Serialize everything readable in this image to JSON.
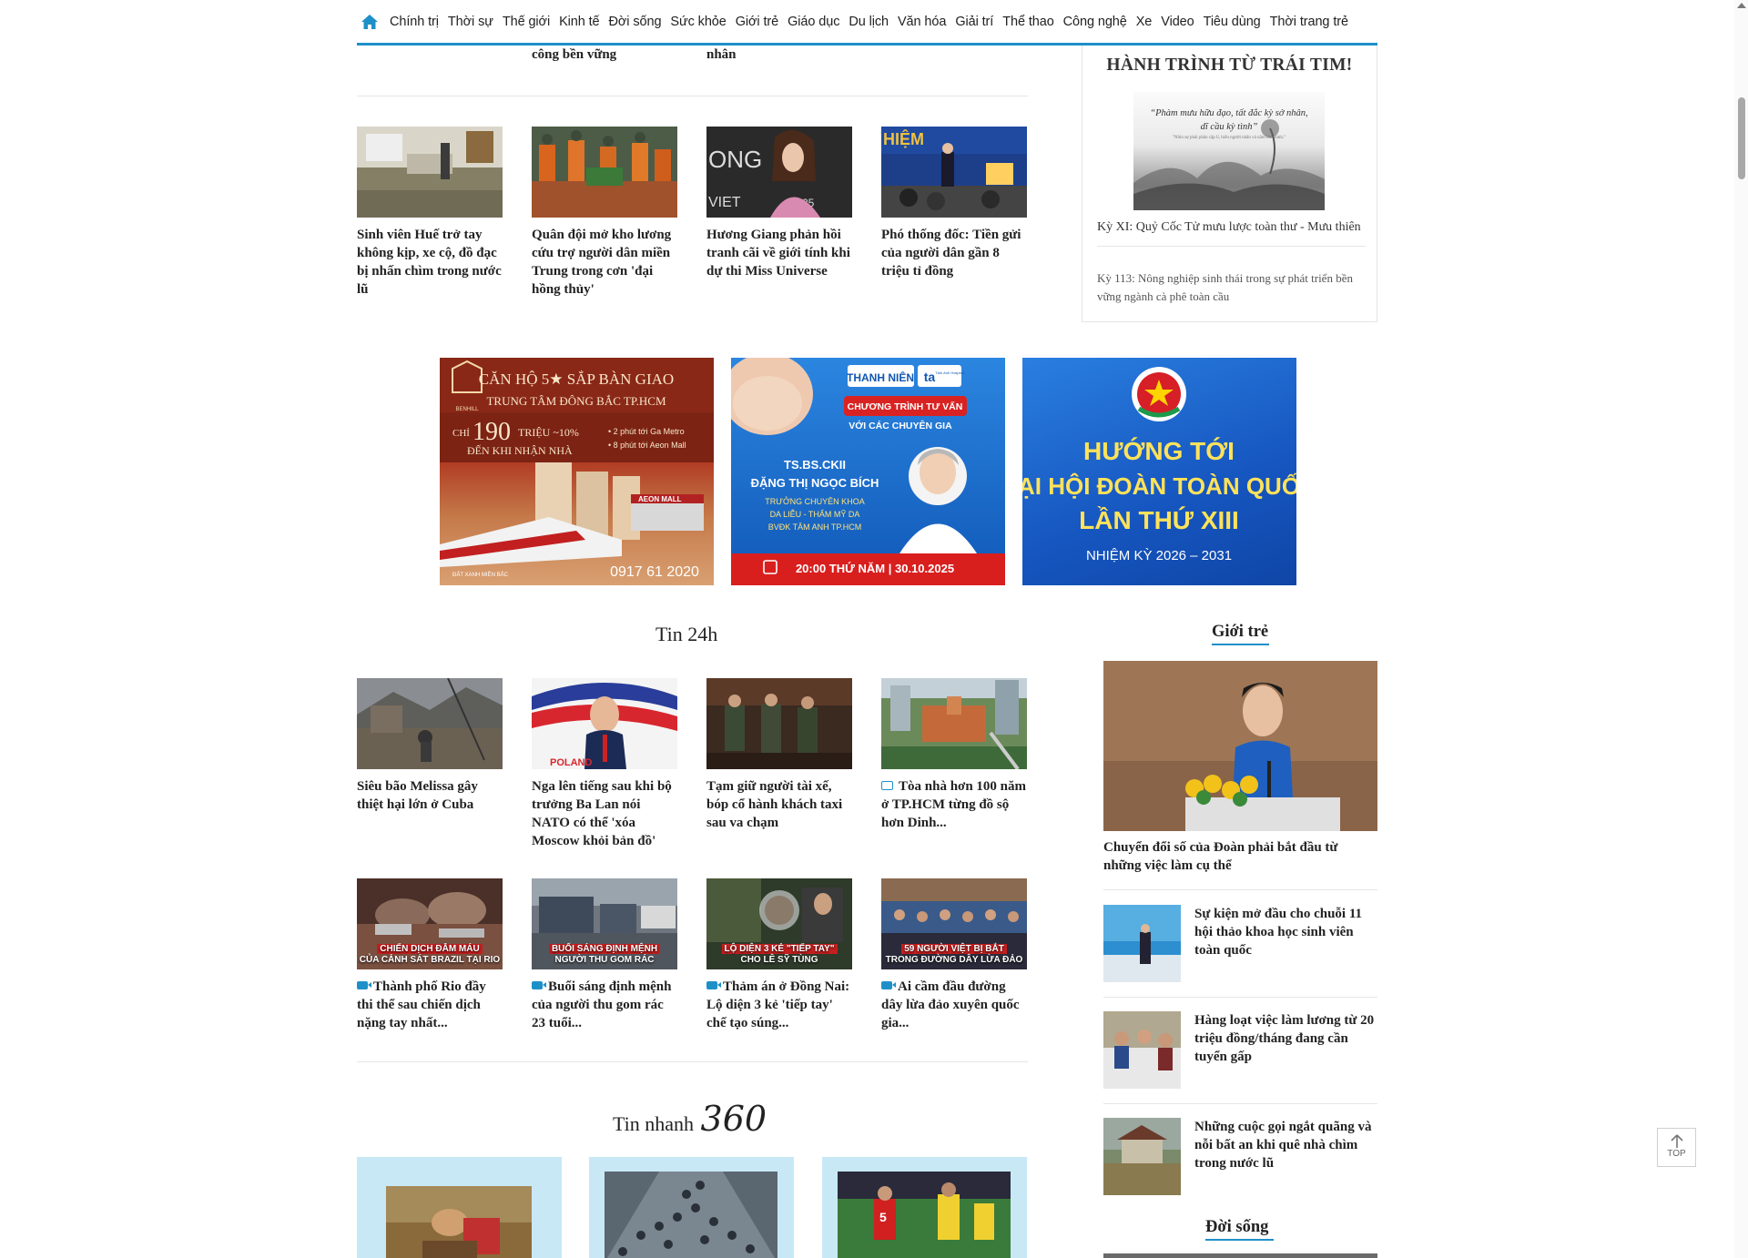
{
  "nav": {
    "items": [
      "Chính trị",
      "Thời sự",
      "Thế giới",
      "Kinh tế",
      "Đời sống",
      "Sức khỏe",
      "Giới trẻ",
      "Giáo dục",
      "Du lịch",
      "Văn hóa",
      "Giải trí",
      "Thể thao",
      "Công nghệ",
      "Xe",
      "Video",
      "Tiêu dùng",
      "Thời trang trẻ"
    ]
  },
  "cut_row": {
    "title_1": "công bền vững",
    "title_2": "nhân"
  },
  "row1": [
    {
      "title": "Sinh viên Huế trở tay không kịp, xe cộ, đồ đạc bị nhấn chìm trong nước lũ"
    },
    {
      "title": "Quân đội mở kho lương cứu trợ người dân miền Trung trong cơn 'đại hồng thủy'"
    },
    {
      "title": "Hương Giang phản hồi tranh cãi về giới tính khi dự thi Miss Universe"
    },
    {
      "title": "Phó thống đốc: Tiền gửi của người dân gần 8 triệu tỉ đồng"
    }
  ],
  "hanh_trinh": {
    "title": "HÀNH TRÌNH TỪ TRÁI TIM!",
    "quote": "“Phàm mưu hữu đạo, tất đắc kỳ sở nhân, dĩ cầu kỳ tình”",
    "quote_small": "\"Nhìn sự phải phân cặp lí, hiểu người nhân và nắm tình hình.\"",
    "link_1": "Kỳ XI: Quỷ Cốc Tử mưu lược toàn thư - Mưu thiên",
    "link_2": "Kỳ 113: Nông nghiệp sinh thái trong sự phát triển bền vững ngành cà phê toàn cầu"
  },
  "ads": {
    "ad1": {
      "brand": "BENHILL",
      "headline": "CĂN HỘ 5★ SẮP BÀN GIAO",
      "sub": "TRUNG TÂM ĐÔNG BẮC TP.HCM",
      "price_prefix": "CHỈ",
      "price": "190",
      "price_suffix": "TRIỆU ~10%",
      "price_line2": "ĐẾN KHI NHẬN NHÀ",
      "bullet_1": "• 2 phút tới Ga Metro",
      "bullet_2": "• 8 phút tới Aeon Mall",
      "mall": "AEON MALL",
      "footer_brand": "ĐẤT XANH MIỀN BẮC",
      "phone": "0917 61 2020"
    },
    "ad2": {
      "logo_1": "THANH NIÊN",
      "logo_2": "ta",
      "logo_2_sub": "Tâm Anh Hospital",
      "program": "CHƯƠNG TRÌNH TƯ VẤN",
      "with": "VỚI CÁC CHUYÊN GIA",
      "degree": "TS.BS.CKII",
      "name": "ĐẶNG THỊ NGỌC BÍCH",
      "role_1": "TRƯỞNG CHUYÊN KHOA",
      "role_2": "DA LIỄU - THẨM MỸ DA",
      "role_3": "BVĐK TÂM ANH TP.HCM",
      "time": "20:00 THỨ NĂM | 30.10.2025"
    },
    "ad3": {
      "line_1": "HƯỚNG TỚI",
      "line_2": "ĐẠI HỘI ĐOÀN TOÀN QUỐC",
      "line_3": "LẦN THỨ XIII",
      "term": "NHIỆM KỲ 2026 – 2031"
    }
  },
  "tin24h": {
    "title": "Tin 24h",
    "row_a": [
      {
        "title": "Siêu bão Melissa gây thiệt hại lớn ở Cuba"
      },
      {
        "title": "Nga lên tiếng sau khi bộ trưởng Ba Lan nói NATO có thể 'xóa Moscow khỏi bản đồ'",
        "thumb_text": "POLAND"
      },
      {
        "title": "Tạm giữ người tài xế, bóp cổ hành khách taxi sau va chạm"
      },
      {
        "title": "Tòa nhà hơn 100 năm ở TP.HCM từng đồ sộ hơn Dinh..."
      }
    ],
    "row_b": [
      {
        "title": "Thành phố Rio đầy thi thể sau chiến dịch nặng tay nhất...",
        "label_1": "CHIẾN DỊCH ĐẪM MÁU",
        "label_2": "CỦA CẢNH SÁT BRAZIL TẠI RIO"
      },
      {
        "title": "Buổi sáng định mệnh của người thu gom rác 23 tuổi...",
        "label_1": "BUỔI SÁNG ĐỊNH MỆNH",
        "label_2": "NGƯỜI THU GOM RÁC"
      },
      {
        "title": "Thảm án ở Đồng Nai: Lộ diện 3 kẻ 'tiếp tay' chế tạo súng...",
        "label_1": "LỘ DIỆN 3 KẺ \"TIẾP TAY\"",
        "label_2": "CHO LÊ SỸ TÙNG"
      },
      {
        "title": "Ai cầm đầu đường dây lừa đảo xuyên quốc gia...",
        "label_1": "59 NGƯỜI VIỆT BỊ BẮT",
        "label_2": "TRONG ĐƯỜNG DÂY LỪA ĐẢO"
      }
    ]
  },
  "gioi_tre": {
    "title": "Giới trẻ",
    "lead_title": "Chuyển đổi số của Đoàn phải bắt đầu từ những việc làm cụ thể",
    "items": [
      {
        "title": "Sự kiện mở đầu cho chuỗi 11 hội thảo khoa học sinh viên toàn quốc"
      },
      {
        "title": "Hàng loạt việc làm lương từ 20 triệu đồng/tháng đang cần tuyển gấp"
      },
      {
        "title": "Những cuộc gọi ngắt quãng và nỗi bất an khi quê nhà chìm trong nước lũ"
      }
    ]
  },
  "doi_song": {
    "title": "Đời sống"
  },
  "tin_nhanh": {
    "title": "Tin nhanh",
    "number": "360"
  },
  "top_button": {
    "label": "TOP"
  },
  "colors": {
    "accent": "#1e90c8"
  }
}
